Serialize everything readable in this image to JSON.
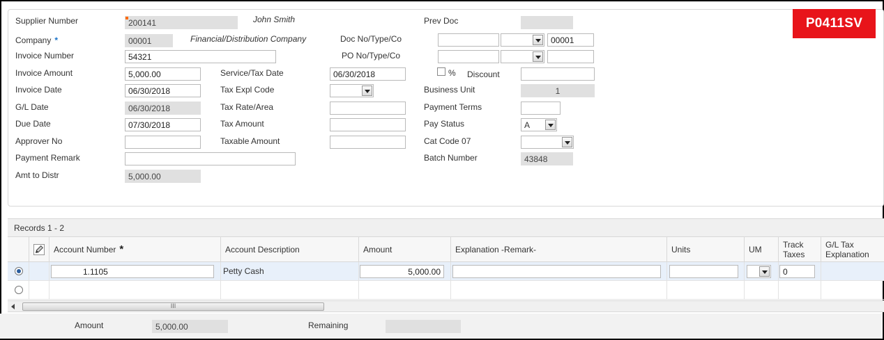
{
  "app": {
    "badge": "P0411SV"
  },
  "form": {
    "supplier_number": {
      "label": "Supplier Number",
      "value": "200141",
      "name": "John Smith"
    },
    "company": {
      "label": "Company",
      "required": "*",
      "value": "00001",
      "name": "Financial/Distribution Company"
    },
    "invoice_number": {
      "label": "Invoice Number",
      "value": "54321"
    },
    "invoice_amount": {
      "label": "Invoice Amount",
      "value": "5,000.00"
    },
    "invoice_date": {
      "label": "Invoice Date",
      "value": "06/30/2018"
    },
    "gl_date": {
      "label": "G/L Date",
      "value": "06/30/2018"
    },
    "due_date": {
      "label": "Due Date",
      "value": "07/30/2018"
    },
    "approver_no": {
      "label": "Approver No",
      "value": ""
    },
    "payment_remark": {
      "label": "Payment Remark",
      "value": ""
    },
    "amt_to_distr": {
      "label": "Amt to Distr",
      "value": "5,000.00"
    },
    "service_tax_date": {
      "label": "Service/Tax Date",
      "value": "06/30/2018"
    },
    "tax_expl_code": {
      "label": "Tax Expl Code",
      "value": ""
    },
    "tax_rate_area": {
      "label": "Tax Rate/Area",
      "value": ""
    },
    "tax_amount": {
      "label": "Tax Amount",
      "value": ""
    },
    "taxable_amount": {
      "label": "Taxable Amount",
      "value": ""
    },
    "prev_doc": {
      "label": "Prev Doc",
      "value": ""
    },
    "doc_no_type_co": {
      "label": "Doc No/Type/Co",
      "no": "",
      "type": "",
      "co": "00001"
    },
    "po_no_type_co": {
      "label": "PO No/Type/Co",
      "no": "",
      "type": "",
      "co": ""
    },
    "discount": {
      "pct_label": "%",
      "label": "Discount",
      "value": ""
    },
    "business_unit": {
      "label": "Business Unit",
      "value": "1"
    },
    "payment_terms": {
      "label": "Payment Terms",
      "value": ""
    },
    "pay_status": {
      "label": "Pay Status",
      "value": "A"
    },
    "cat_code_07": {
      "label": "Cat Code 07",
      "value": ""
    },
    "batch_number": {
      "label": "Batch Number",
      "value": "43848"
    }
  },
  "grid": {
    "title": "Records 1 - 2",
    "columns": {
      "account_number": "Account Number",
      "account_number_req": "*",
      "account_description": "Account Description",
      "amount": "Amount",
      "explanation": "Explanation -Remark-",
      "units": "Units",
      "um": "UM",
      "track_taxes": "Track Taxes",
      "gl_tax_explanation": "G/L Tax Explanation"
    },
    "rows": [
      {
        "account_number": "1.1105",
        "account_description": "Petty Cash",
        "amount": "5,000.00",
        "explanation": "",
        "units": "",
        "um": "",
        "track_taxes": "0"
      }
    ],
    "scroll_thumb": "III"
  },
  "footer": {
    "amount_label": "Amount",
    "amount_value": "5,000.00",
    "remaining_label": "Remaining",
    "remaining_value": ""
  },
  "colors": {
    "badge": "#e8141a",
    "required": "#1a73c8",
    "selected_row": "#e8f0fa"
  }
}
